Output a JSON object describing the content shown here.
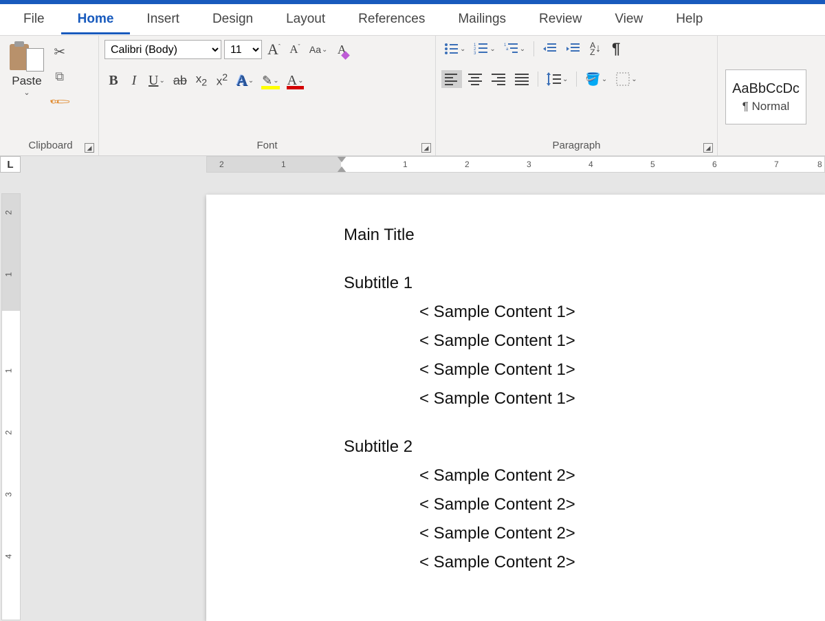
{
  "tabs": [
    "File",
    "Home",
    "Insert",
    "Design",
    "Layout",
    "References",
    "Mailings",
    "Review",
    "View",
    "Help"
  ],
  "active_tab": "Home",
  "clipboard": {
    "paste": "Paste",
    "group_label": "Clipboard"
  },
  "font": {
    "name": "Calibri (Body)",
    "size": "11",
    "grow": "A",
    "shrink": "A",
    "case": "Aa",
    "bold": "B",
    "italic": "I",
    "underline": "U",
    "strike": "ab",
    "subscript": "x",
    "subscript_sub": "2",
    "superscript": "x",
    "superscript_sup": "2",
    "effects": "A",
    "fontcolor": "A",
    "group_label": "Font"
  },
  "paragraph": {
    "sort": "A",
    "sort2": "Z",
    "pilcrow": "¶",
    "group_label": "Paragraph"
  },
  "styles": {
    "sample": "AaBbCcDc",
    "name": "¶ Normal"
  },
  "ruler": {
    "tabstop": "L",
    "h_numbers": [
      "2",
      "1",
      "1",
      "2",
      "3",
      "4",
      "5",
      "6",
      "7",
      "8"
    ],
    "v_numbers": [
      "2",
      "1",
      "1",
      "2",
      "3",
      "4"
    ]
  },
  "document": {
    "title": "Main Title",
    "sections": [
      {
        "subtitle": "Subtitle 1",
        "lines": [
          "< Sample Content 1>",
          "< Sample Content 1>",
          "< Sample Content 1>",
          "< Sample Content 1>"
        ]
      },
      {
        "subtitle": "Subtitle 2",
        "lines": [
          "< Sample Content 2>",
          "< Sample Content 2>",
          "< Sample Content 2>",
          "< Sample Content 2>"
        ]
      }
    ]
  }
}
